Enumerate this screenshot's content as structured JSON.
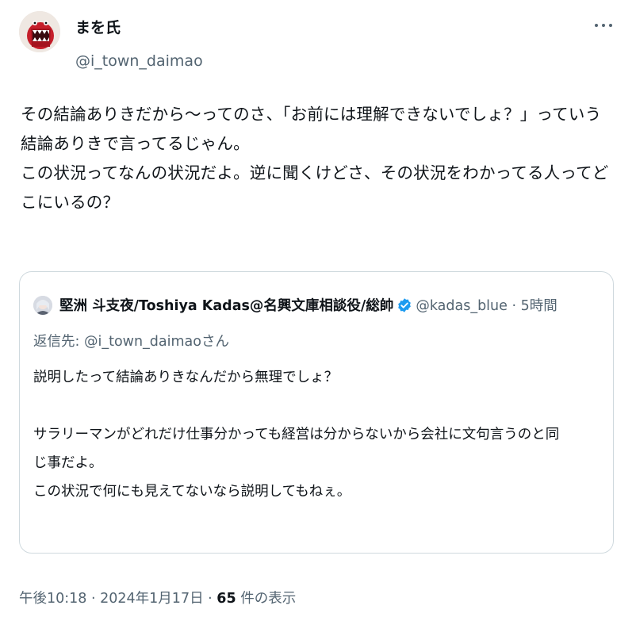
{
  "author": {
    "display_name": "まを氏",
    "handle": "@i_town_daimao",
    "avatar_icon": "red-creature-avatar-icon"
  },
  "more_icon": "more-dots-icon",
  "tweet_lines": [
    "その結論ありきだから〜ってのさ、「お前には理解できないでしょ？」っていう",
    "結論ありきで言ってるじゃん。",
    "この状況ってなんの状況だよ。逆に聞くけどさ、その状況をわかってる人ってど",
    "こにいるの？"
  ],
  "quoted": {
    "display_name": "堅洲 斗支夜/Toshiya Kadas@名興文庫相談役/総帥",
    "verified_icon": "verified-badge-icon",
    "handle": "@kadas_blue",
    "separator": " · ",
    "time": "5時間",
    "reply_prefix": "返信先: ",
    "reply_mention": "@i_town_daimao",
    "reply_suffix": "さん",
    "lines": [
      "説明したって結論ありきなんだから無理でしょ？",
      "",
      "サラリーマンがどれだけ仕事分かっても経営は分からないから会社に文句言うのと同",
      "じ事だよ。",
      "この状況で何にも見えてないなら説明してもねぇ。"
    ]
  },
  "meta": {
    "time": "午後10:18",
    "sep1": " · ",
    "date": "2024年1月17日",
    "sep2": " · ",
    "views_count": "65",
    "views_label": " 件の表示"
  },
  "colors": {
    "text": "#0f1419",
    "secondary": "#536471",
    "border": "#cfd9de",
    "verified": "#1d9bf0"
  }
}
